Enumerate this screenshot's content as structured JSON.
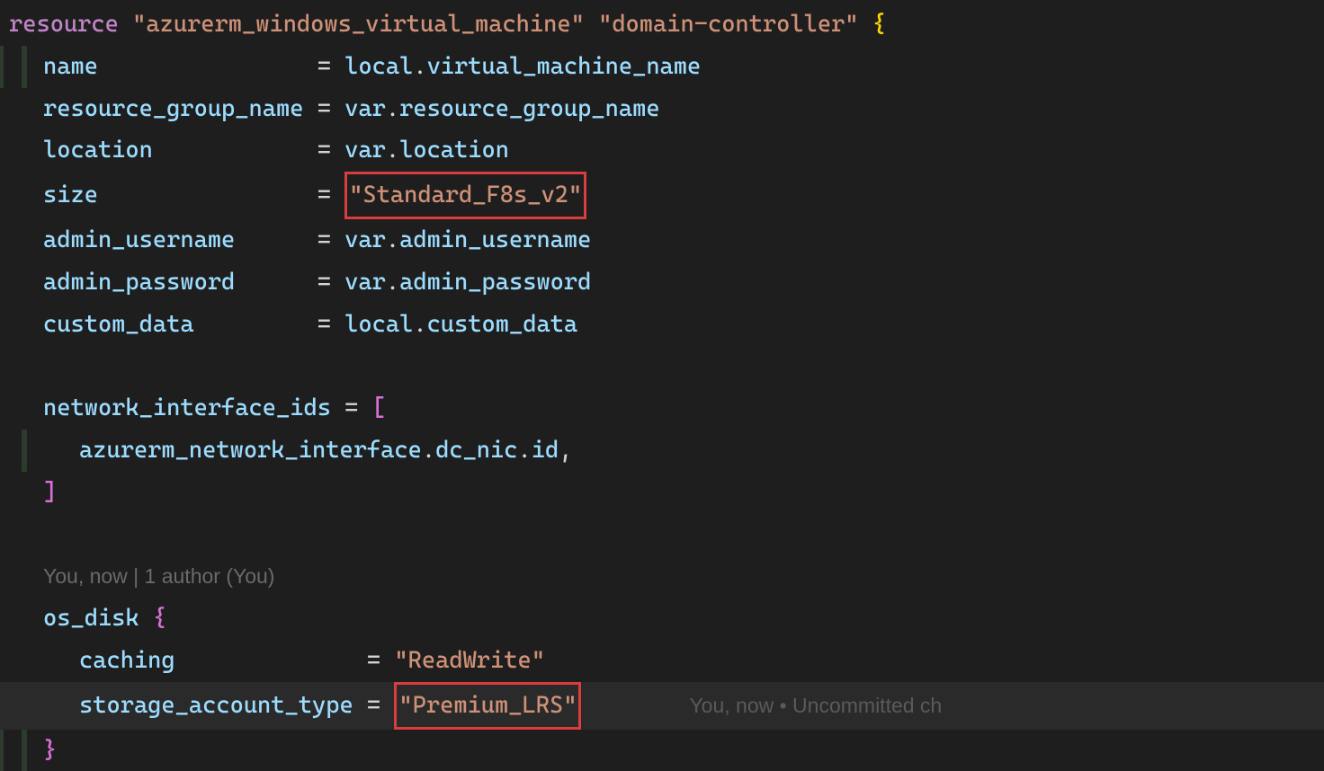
{
  "code": {
    "line1": {
      "kw": "resource",
      "type": "\"azurerm_windows_virtual_machine\"",
      "name": "\"domain-controller\"",
      "brace": "{"
    },
    "line2": {
      "key": "name",
      "pad": "                ",
      "eq": "= ",
      "ns": "local",
      "dot": ".",
      "val": "virtual_machine_name"
    },
    "line3": {
      "key": "resource_group_name",
      "pad": " ",
      "eq": "= ",
      "ns": "var",
      "dot": ".",
      "val": "resource_group_name"
    },
    "line4": {
      "key": "location",
      "pad": "            ",
      "eq": "= ",
      "ns": "var",
      "dot": ".",
      "val": "location"
    },
    "line5": {
      "key": "size",
      "pad": "                ",
      "eq": "= ",
      "val": "\"Standard_F8s_v2\""
    },
    "line6": {
      "key": "admin_username",
      "pad": "      ",
      "eq": "= ",
      "ns": "var",
      "dot": ".",
      "val": "admin_username"
    },
    "line7": {
      "key": "admin_password",
      "pad": "      ",
      "eq": "= ",
      "ns": "var",
      "dot": ".",
      "val": "admin_password"
    },
    "line8": {
      "key": "custom_data",
      "pad": "         ",
      "eq": "= ",
      "ns": "local",
      "dot": ".",
      "val": "custom_data"
    },
    "line10": {
      "key": "network_interface_ids",
      "eq": " = ",
      "bracket": "["
    },
    "line11": {
      "ns1": "azurerm_network_interface",
      "dot1": ".",
      "ns2": "dc_nic",
      "dot2": ".",
      "val": "id",
      "comma": ","
    },
    "line12": {
      "bracket": "]"
    },
    "blame1": "You, now | 1 author (You)",
    "line14": {
      "key": "os_disk",
      "brace": " {"
    },
    "line15": {
      "key": "caching",
      "pad": "              ",
      "eq": "= ",
      "val": "\"ReadWrite\""
    },
    "line16": {
      "key": "storage_account_type",
      "pad": " ",
      "eq": "= ",
      "val": "\"Premium_LRS\""
    },
    "blame2": "You, now • Uncommitted ch",
    "line17": {
      "brace": "}"
    }
  }
}
